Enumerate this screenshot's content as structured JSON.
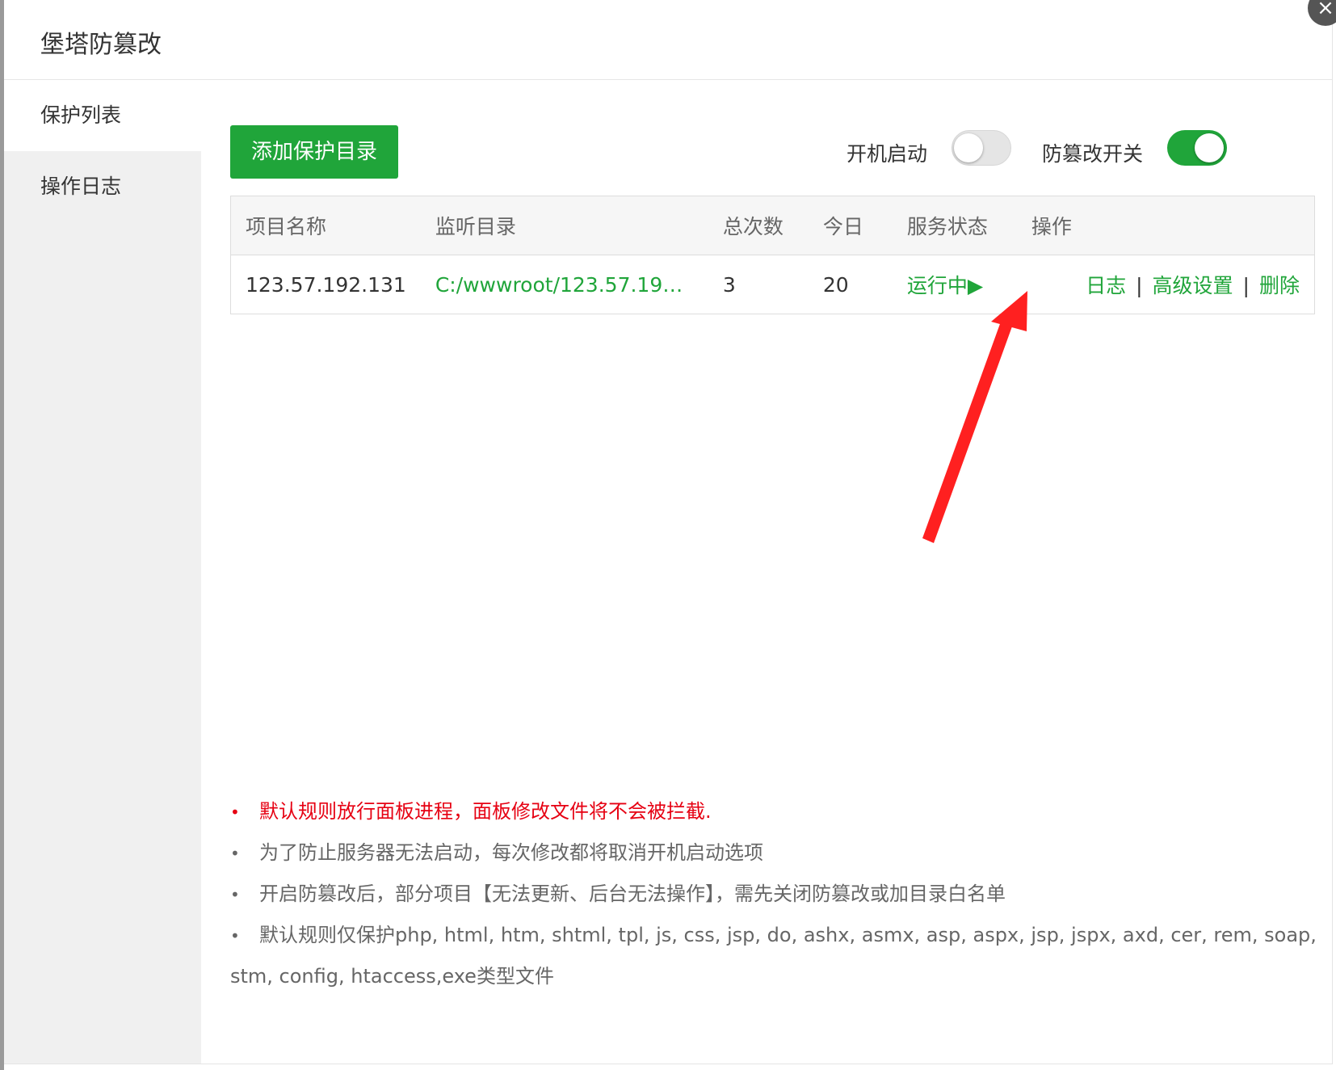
{
  "dialog": {
    "title": "堡塔防篡改",
    "close_icon": "close-icon"
  },
  "sidebar": {
    "items": [
      {
        "label": "保护列表",
        "active": true
      },
      {
        "label": "操作日志",
        "active": false
      }
    ]
  },
  "toolbar": {
    "add_label": "添加保护目录",
    "boot_start_label": "开机启动",
    "boot_start_on": false,
    "tamper_switch_label": "防篡改开关",
    "tamper_switch_on": true
  },
  "table": {
    "headers": [
      "项目名称",
      "监听目录",
      "总次数",
      "今日",
      "服务状态",
      "操作"
    ],
    "rows": [
      {
        "name": "123.57.192.131",
        "path": "C:/wwwroot/123.57.192…",
        "total": "3",
        "today": "20",
        "status": "运行中▶",
        "op_log": "日志",
        "op_sep": "|",
        "op_advanced": "高级设置",
        "op_delete": "删除"
      }
    ]
  },
  "tips": [
    "默认规则放行面板进程，面板修改文件将不会被拦截.",
    "为了防止服务器无法启动，每次修改都将取消开机启动选项",
    "开启防篡改后，部分项目【无法更新、后台无法操作】，需先关闭防篡改或加目录白名单",
    "默认规则仅保护php, html, htm, shtml, tpl, js, css, jsp, do, ashx, asmx, asp, aspx, jsp, jspx, axd, cer, rem, soap,",
    "stm, config, htaccess,exe类型文件"
  ],
  "tip_bullet": "•",
  "colors": {
    "accent": "#20a53a",
    "warning": "#e60012",
    "annotation_arrow": "#ff2020"
  }
}
